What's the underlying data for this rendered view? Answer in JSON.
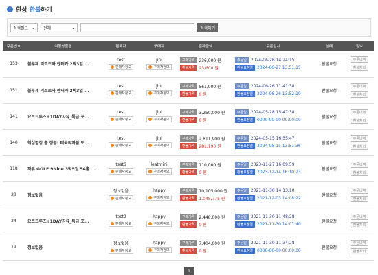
{
  "header": {
    "title_prefix": "환상 ",
    "title_accent": "환불",
    "title_suffix": "하기",
    "icon": "info-circle-icon"
  },
  "search": {
    "field_select": "검색필드",
    "status_select": "전체",
    "query": "",
    "button": "검색하기"
  },
  "columns": [
    "주문번호",
    "여행상품명",
    "판매자",
    "구매자",
    "결제금액",
    "주문일시",
    "상태",
    "정보"
  ],
  "labels": {
    "seller_info": "판매자정보",
    "buyer_info": "구매자정보",
    "paid": "구매가격",
    "refund": "환불가격",
    "order_date": "주문일",
    "refund_date": "환불요청일",
    "btn_order": "주문내역",
    "btn_refund": "환불처리"
  },
  "rows": [
    {
      "id": "153",
      "name": "블루제 리조트와 렌터카 2박3일 ...",
      "seller": "test",
      "buyer": "jini",
      "paid": "236,000 원",
      "refund": "23,600 원",
      "refund_red": true,
      "order_dt": "2024-06-26 14:24:15",
      "refund_dt": "2024-06-27 13:51:15",
      "status": "환불요청"
    },
    {
      "id": "151",
      "name": "블루제 리조트와 렌터카 2박3일 ...",
      "seller": "test",
      "buyer": "jini",
      "paid": "561,000 원",
      "refund": "0 원",
      "refund_red": true,
      "order_dt": "2024-06-26 11:41:38",
      "refund_dt": "2024-06-26 13:52:19",
      "status": "환불요청"
    },
    {
      "id": "141",
      "name": "요트크루즈+1DAY자유_특급 포...",
      "seller": "test",
      "buyer": "jini",
      "paid": "3,250,000 원",
      "refund": "0 원",
      "refund_red": true,
      "order_dt": "2024-05-28 15:47:38",
      "refund_dt": "0000-00-00 00:00:00",
      "status": "환불요청"
    },
    {
      "id": "140",
      "name": "핵심명정 총 정렴! 태국의자볼 도...",
      "seller": "test",
      "buyer": "jini",
      "paid": "2,811,900 원",
      "refund": "281,190 원",
      "refund_red": true,
      "order_dt": "2024-05-15 16:55:47",
      "refund_dt": "2024-05-15 13:51:36",
      "status": "환불요청"
    },
    {
      "id": "118",
      "name": "자유 GOLF 9Nine 3박5일 54홀 ...",
      "seller": "test6",
      "buyer": "leatmini",
      "paid": "110,000 원",
      "refund": "0 원",
      "refund_red": true,
      "order_dt": "2023-11-27 16:09:59",
      "refund_dt": "2023-12-14 16:10:23",
      "status": "환불요청"
    },
    {
      "id": "29",
      "name": "정보없음",
      "seller": "정보없음",
      "buyer": "happy",
      "paid": "10,105,000 원",
      "refund": "1,048,775 원",
      "refund_red": true,
      "order_dt": "2021-11-30 14:13:10",
      "refund_dt": "2021-12-03 14:08:22",
      "status": "환불요청"
    },
    {
      "id": "24",
      "name": "요트크루즈+1DAY자유_특급 포...",
      "seller": "test2",
      "buyer": "happy",
      "paid": "2,448,000 원",
      "refund": "0 원",
      "refund_red": true,
      "order_dt": "2021-11-30 11:48:28",
      "refund_dt": "2021-11-30 14:07:40",
      "status": "환불요청"
    },
    {
      "id": "19",
      "name": "정보없음",
      "seller": "정보없음",
      "buyer": "happy",
      "paid": "7,404,000 원",
      "refund": "0 원",
      "refund_red": true,
      "order_dt": "2021-11-30 11:34:28",
      "refund_dt": "0000-00-00 00:00:00",
      "status": "환불요청"
    }
  ],
  "pagination": {
    "current": "1"
  },
  "colors": {
    "accent": "#3a7bd5",
    "header_bg": "#555555",
    "refund_red": "#d93025",
    "tag_dot": "#f08a1c"
  }
}
